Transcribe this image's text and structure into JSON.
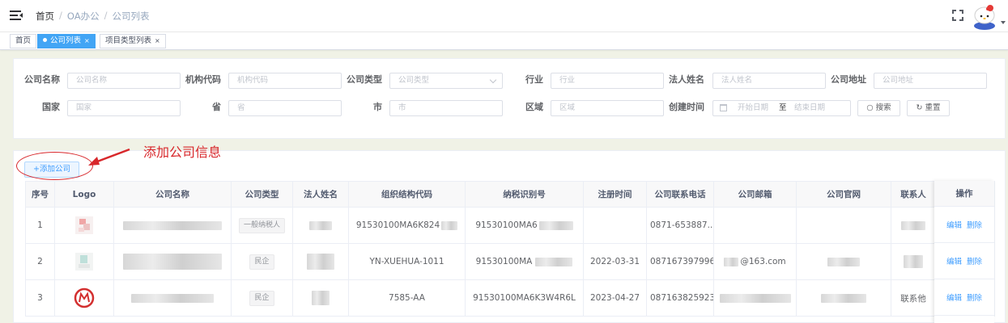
{
  "breadcrumb": {
    "home": "首页",
    "section": "OA办公",
    "current": "公司列表",
    "sep": "/"
  },
  "tags": [
    {
      "label": "首页",
      "active": false,
      "closable": false
    },
    {
      "label": "公司列表",
      "active": true,
      "closable": true
    },
    {
      "label": "项目类型列表",
      "active": false,
      "closable": true
    }
  ],
  "tag_close": "×",
  "search": {
    "row1": [
      {
        "label": "公司名称",
        "placeholder": "公司名称",
        "select": false
      },
      {
        "label": "机构代码",
        "placeholder": "机构代码",
        "select": false
      },
      {
        "label": "公司类型",
        "placeholder": "公司类型",
        "select": true
      },
      {
        "label": "行业",
        "placeholder": "行业",
        "select": false
      },
      {
        "label": "法人姓名",
        "placeholder": "法人姓名",
        "select": false
      },
      {
        "label": "公司地址",
        "placeholder": "公司地址",
        "select": false
      }
    ],
    "row2": [
      {
        "label": "国家",
        "placeholder": "国家"
      },
      {
        "label": "省",
        "placeholder": "省"
      },
      {
        "label": "市",
        "placeholder": "市"
      },
      {
        "label": "区域",
        "placeholder": "区域"
      }
    ],
    "created_label": "创建时间",
    "start_placeholder": "开始日期",
    "range_sep": "至",
    "end_placeholder": "结束日期",
    "search_button": "搜索",
    "reset_button": "重置"
  },
  "add_button": "+添加公司",
  "annotation": "添加公司信息",
  "table": {
    "headers": [
      "序号",
      "Logo",
      "公司名称",
      "公司类型",
      "法人姓名",
      "组织结构代码",
      "纳税识别号",
      "注册时间",
      "公司联系电话",
      "公司邮箱",
      "公司官网",
      "联系人",
      "操作"
    ],
    "rows": [
      {
        "index": "1",
        "type": "一般纳税人",
        "org_code": "91530100MA6K824",
        "tax_id": "91530100MA6",
        "reg_date": "",
        "phone": "0871-653887...",
        "email": "",
        "contact": ""
      },
      {
        "index": "2",
        "type": "民企",
        "org_code": "YN-XUEHUA-1011",
        "tax_id": "91530100MA",
        "reg_date": "2022-03-31",
        "phone": "087167397996",
        "email": "@163.com",
        "contact": ""
      },
      {
        "index": "3",
        "type": "民企",
        "org_code": "7585-AA",
        "tax_id": "91530100MA6K3W4R6L",
        "reg_date": "2023-04-27",
        "phone": "087163825923",
        "email": "",
        "contact": "联系他"
      }
    ],
    "edit": "编辑",
    "delete": "删除"
  },
  "colors": {
    "primary": "#409eff",
    "active_tag": "#42a5f5",
    "annotation": "#d8272b",
    "page_bg": "#f0f2e6"
  },
  "icons": [
    "hamburger-icon",
    "fullscreen-icon",
    "avatar-hello-kitty",
    "calendar-icon",
    "search-icon",
    "refresh-icon",
    "chevron-down-icon"
  ]
}
